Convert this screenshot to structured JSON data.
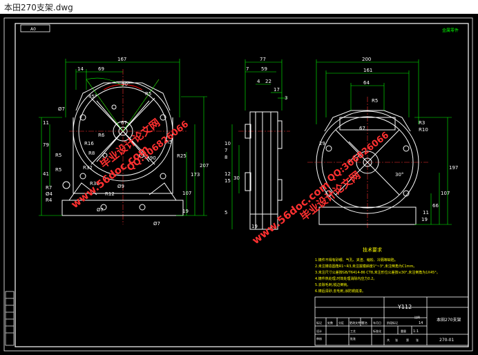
{
  "window": {
    "title": "本田270支架.dwg"
  },
  "sheet": {
    "size_label": "A0",
    "corner_mark": "金属零件"
  },
  "front_view": {
    "dims": [
      "167",
      "14",
      "69",
      "90°",
      "45°",
      "R5",
      "R5",
      "R5",
      "R5",
      "R7",
      "R4",
      "R6",
      "R8",
      "R16",
      "R90",
      "R25",
      "R30",
      "R32",
      "R12",
      "Ø7",
      "Ø7",
      "Ø7",
      "Ø9",
      "Ø4",
      "67",
      "11",
      "79",
      "41",
      "107",
      "173",
      "207",
      "19"
    ]
  },
  "side_view": {
    "dims": [
      "77",
      "7",
      "59",
      "4",
      "22",
      "17",
      "3",
      "10",
      "7",
      "8",
      "12",
      "15",
      "30",
      "5",
      "19"
    ]
  },
  "right_view": {
    "dims": [
      "200",
      "161",
      "64",
      "R5",
      "R3",
      "R10",
      "67",
      "29",
      "30°",
      "197",
      "107",
      "66",
      "19",
      "11"
    ]
  },
  "notes": {
    "heading": "技术要求",
    "lines": [
      "1.铸件不得有砂眼、气孔、夹渣、缩松、冷隔等缺陷。",
      "2.未注铸造圆角R1~R3,未注拔模斜度1°~3°,未注倒角为C1mm。",
      "3.未注尺寸公差按GB/T6414-86 CT8,未注形位公差按≤30°,未注倒角为1X45°。",
      "4.铸件热处理,时效处理消除内应力0.2。",
      "5.去除毛刺,锐边倒钝。",
      "6.铸后清砂,去毛刺,涂防锈底漆。"
    ]
  },
  "titleblock": {
    "material": "Y112",
    "part_name": "本田270支架",
    "drawing_no": "270-01",
    "scale": "1:1",
    "sheet_count": "14",
    "headers": [
      "标记",
      "处数",
      "分区",
      "更改文件号",
      "签名",
      "年月日"
    ],
    "rows": [
      "设计",
      "审核",
      "工艺",
      "批准"
    ],
    "cells": [
      "标准化",
      "阶段标记",
      "重量",
      "比例",
      "共",
      "张",
      "第",
      "张"
    ]
  },
  "watermarks": {
    "site": "www.56doc.com",
    "qq": "QQ:306826066",
    "brand": "毕业设计论文网"
  },
  "colors": {
    "background": "#000000",
    "line": "#ffffff",
    "accent": "#ff0000",
    "dim": "#00ff00",
    "centerline": "#ff3030",
    "text": "#ffff00"
  }
}
